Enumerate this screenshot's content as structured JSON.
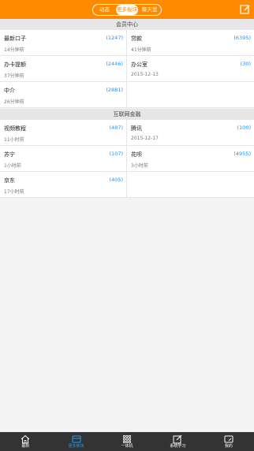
{
  "header": {
    "tabs": [
      {
        "label": "动态"
      },
      {
        "label": "更多板块"
      },
      {
        "label": "聊天室"
      }
    ],
    "active_tab": 1,
    "right_icon": "edit-icon"
  },
  "sections": [
    {
      "title": "会员中心",
      "items": [
        {
          "name": "最新口子",
          "count": "(1247)",
          "time": "14分钟前"
        },
        {
          "name": "贷款",
          "count": "(6395)",
          "time": "41分钟前"
        },
        {
          "name": "办卡提额",
          "count": "(2446)",
          "time": "37分钟前"
        },
        {
          "name": "办公室",
          "count": "(30)",
          "time": "2015-12-13"
        },
        {
          "name": "中介",
          "count": "(2881)",
          "time": "26分钟前"
        }
      ]
    },
    {
      "title": "互联网金融",
      "items": [
        {
          "name": "视频教程",
          "count": "(487)",
          "time": "11小时前"
        },
        {
          "name": "腾讯",
          "count": "(100)",
          "time": "2015-12-17"
        },
        {
          "name": "苏宁",
          "count": "(107)",
          "time": "1小时前"
        },
        {
          "name": "花呗",
          "count": "(4955)",
          "time": "3小时前"
        },
        {
          "name": "京东",
          "count": "(405)",
          "time": "17小时前"
        }
      ]
    }
  ],
  "bottom_nav": [
    {
      "label": "最新",
      "icon": "home-icon"
    },
    {
      "label": "更多板块",
      "icon": "board-icon",
      "active": true
    },
    {
      "label": "一体机",
      "icon": "grid-icon"
    },
    {
      "label": "系统学习",
      "icon": "edit-icon"
    },
    {
      "label": "我的",
      "icon": "profile-icon"
    }
  ],
  "colors": {
    "accent": "#ff8a00",
    "link": "#1e90ff",
    "tab_active": "#1da1f2"
  }
}
